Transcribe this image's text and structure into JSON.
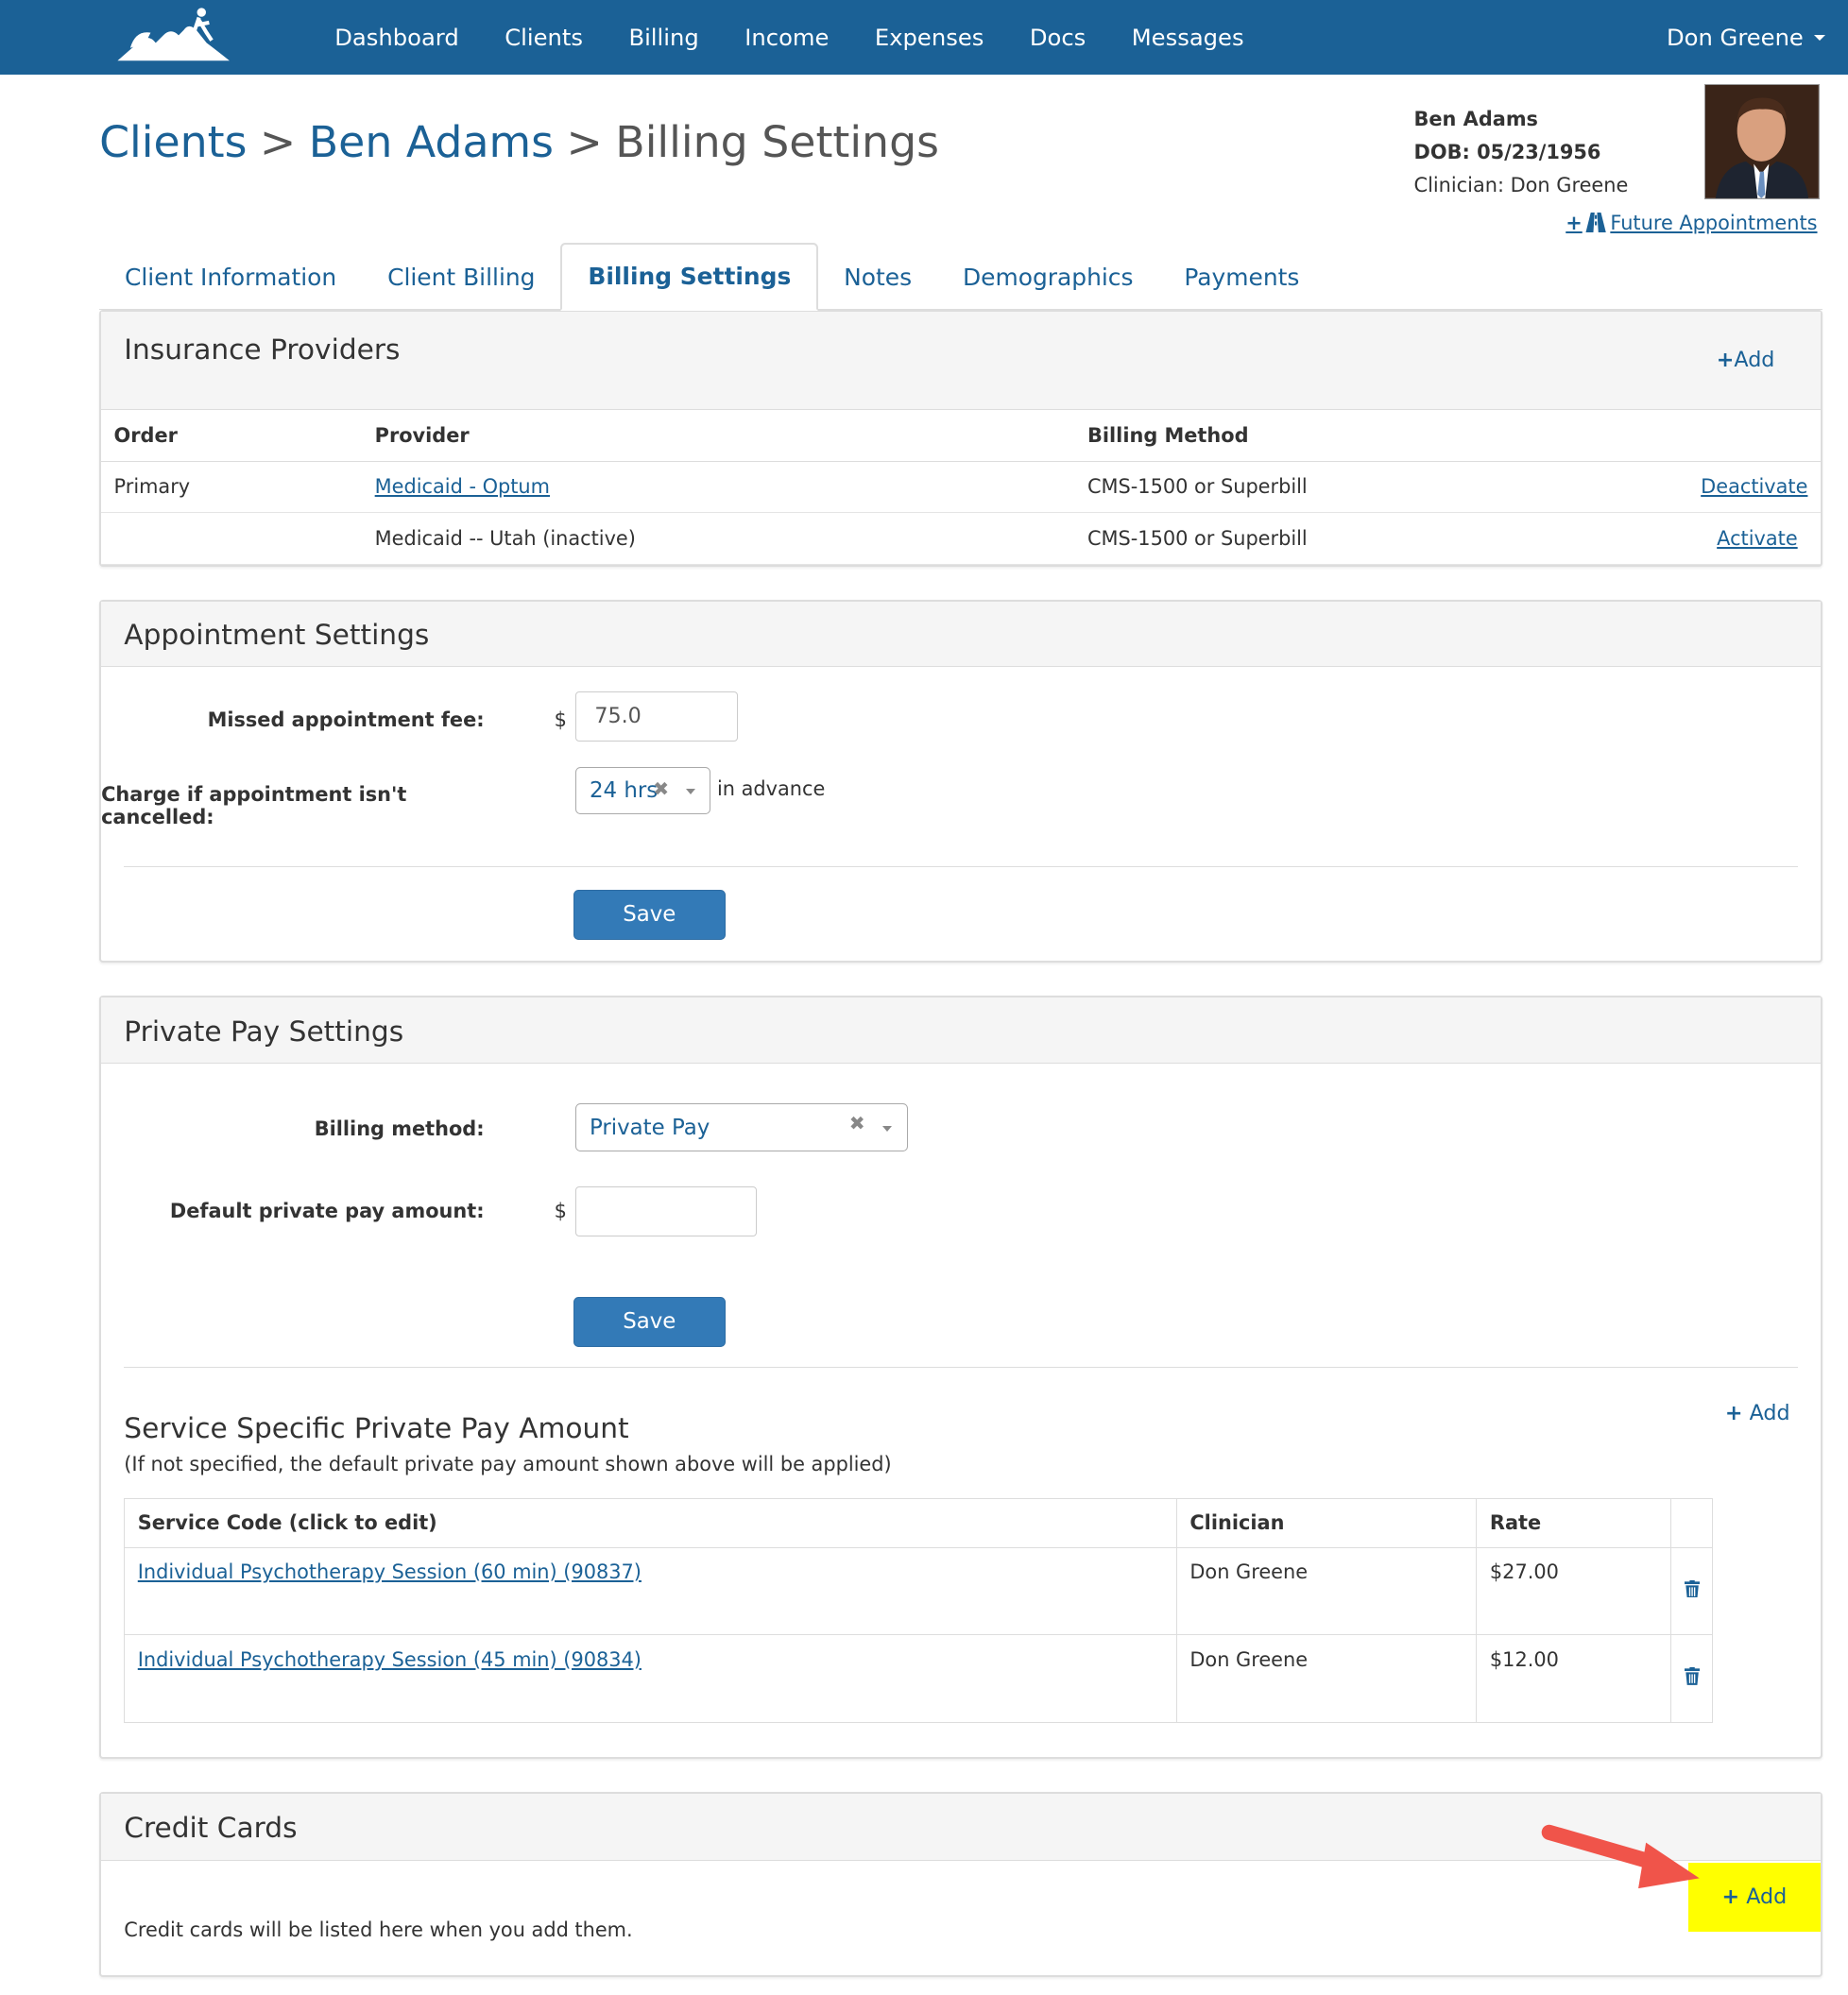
{
  "nav": {
    "items": [
      "Dashboard",
      "Clients",
      "Billing",
      "Income",
      "Expenses",
      "Docs",
      "Messages"
    ],
    "user": "Don Greene"
  },
  "breadcrumb": {
    "part1": "Clients",
    "sep1": ">",
    "part2": "Ben Adams",
    "sep2": ">",
    "part3": "Billing Settings"
  },
  "client": {
    "name": "Ben Adams",
    "dob": "DOB: 05/23/1956",
    "clinician": "Clinician: Don Greene",
    "future_link": "Future Appointments"
  },
  "tabs": [
    "Client Information",
    "Client Billing",
    "Billing Settings",
    "Notes",
    "Demographics",
    "Payments"
  ],
  "insurance": {
    "title": "Insurance Providers",
    "add_label": "Add",
    "headers": [
      "Order",
      "Provider",
      "Billing Method"
    ],
    "rows": [
      {
        "order": "Primary",
        "provider": "Medicaid - Optum",
        "method": "CMS-1500 or Superbill",
        "action": "Deactivate"
      },
      {
        "order": "",
        "provider": "Medicaid -- Utah (inactive)",
        "method": "CMS-1500 or Superbill",
        "action": "Activate"
      }
    ]
  },
  "appointment": {
    "title": "Appointment Settings",
    "fee_label": "Missed appointment fee:",
    "dollar": "$",
    "fee_value": "75.0",
    "cancel_label": "Charge if appointment isn't cancelled:",
    "cancel_value": "24 hrs",
    "cancel_suffix": "in advance",
    "save_label": "Save"
  },
  "private_pay": {
    "title": "Private Pay Settings",
    "method_label": "Billing method:",
    "method_value": "Private Pay",
    "amount_label": "Default private pay amount:",
    "dollar": "$",
    "amount_value": "",
    "save_label": "Save",
    "service_title": "Service Specific Private Pay Amount",
    "service_note": "(If not specified, the default private pay amount shown above will be applied)",
    "add_label": "Add",
    "headers": [
      "Service Code (click to edit)",
      "Clinician",
      "Rate"
    ],
    "rows": [
      {
        "code": "Individual Psychotherapy Session (60 min) (90837)",
        "clinician": "Don Greene",
        "rate": "$27.00"
      },
      {
        "code": "Individual Psychotherapy Session (45 min) (90834)",
        "clinician": "Don Greene",
        "rate": "$12.00"
      }
    ]
  },
  "credit_cards": {
    "title": "Credit Cards",
    "empty_text": "Credit cards will be listed here when you add them.",
    "add_label": "Add",
    "highlight_color": "#ffff00",
    "arrow_color": "#f0544a"
  },
  "icons": {
    "plus": "plus-icon",
    "trash": "trash-icon",
    "clear": "clear-icon",
    "caret": "caret-down-icon",
    "road": "road-icon"
  }
}
